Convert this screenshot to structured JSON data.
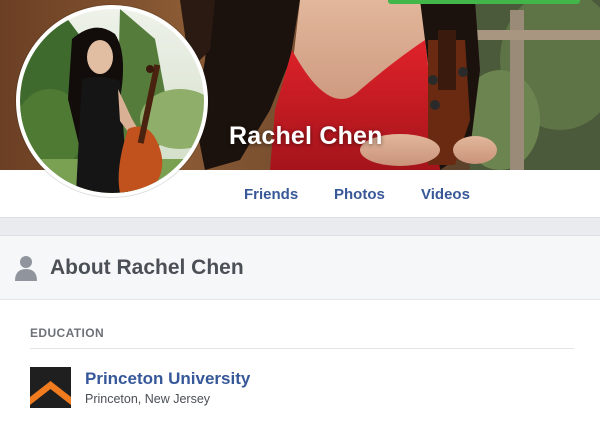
{
  "profile": {
    "name": "Rachel Chen"
  },
  "nav": {
    "items": [
      {
        "label": "Friends"
      },
      {
        "label": "Photos"
      },
      {
        "label": "Videos"
      }
    ]
  },
  "about": {
    "title": "About Rachel Chen",
    "icon": "person-icon",
    "sections": [
      {
        "label": "EDUCATION",
        "entries": [
          {
            "name": "Princeton University",
            "location": "Princeton, New Jersey",
            "icon": "shield-logo"
          }
        ]
      }
    ]
  },
  "colors": {
    "link": "#385898",
    "header_bg": "#f6f7f9",
    "page_bg": "#e9ebee",
    "progress": "#43b649",
    "logo_dark": "#1f1f1f",
    "logo_orange": "#f07c1f"
  }
}
